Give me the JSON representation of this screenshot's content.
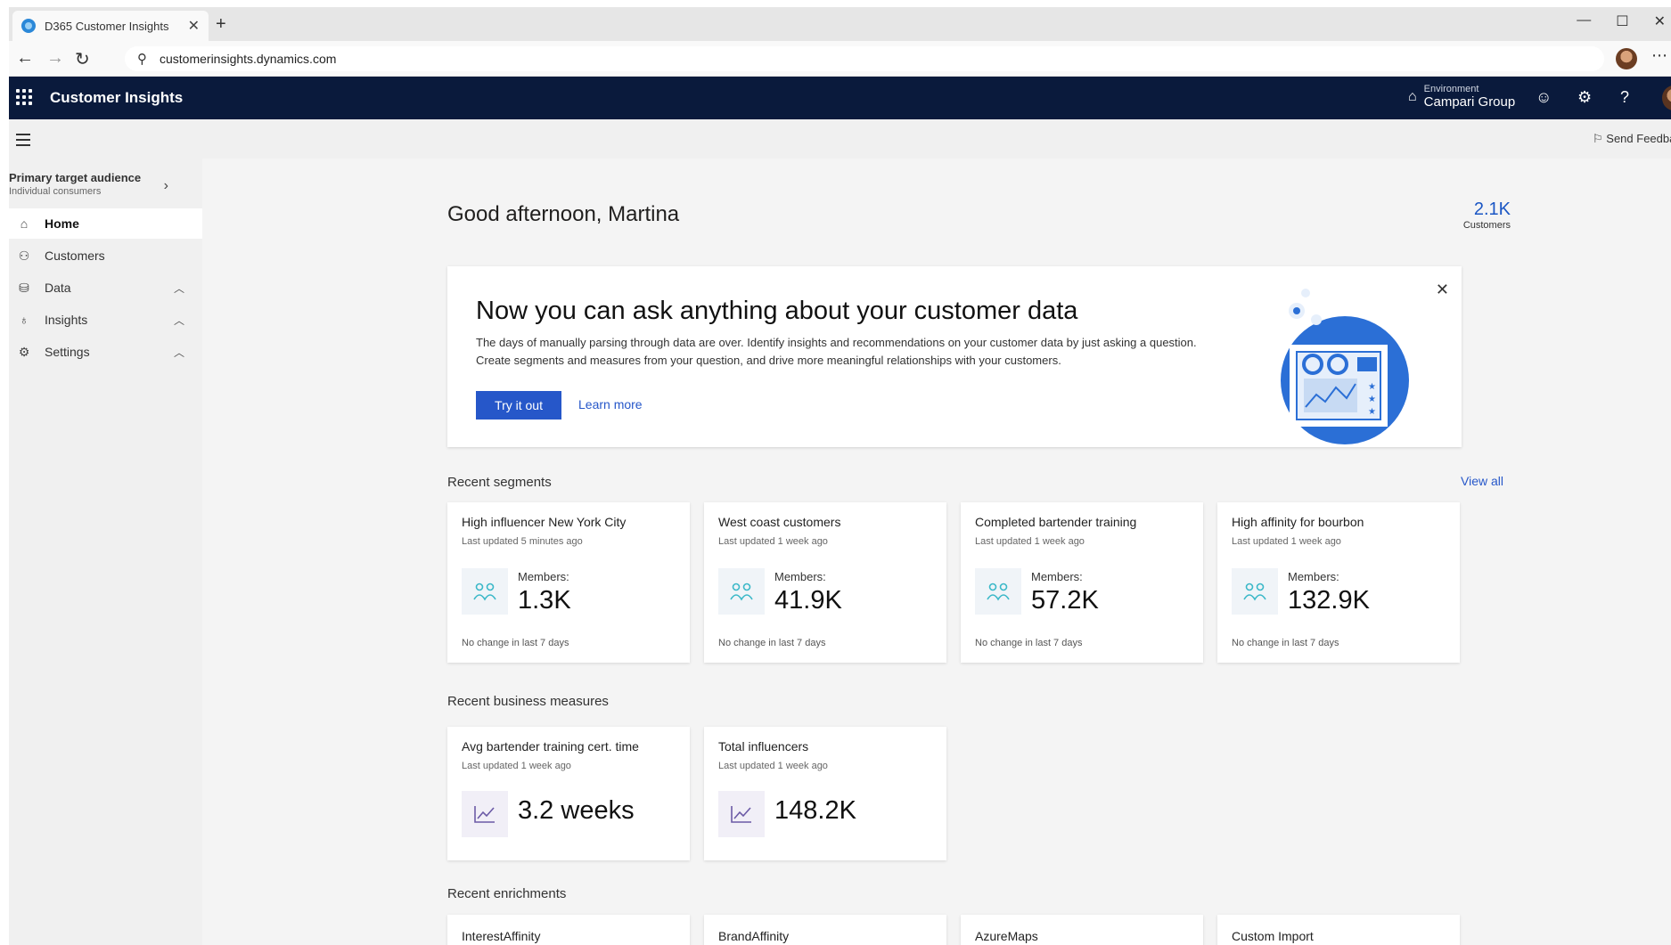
{
  "browser": {
    "tab_title": "D365 Customer Insights",
    "url": "customerinsights.dynamics.com"
  },
  "header": {
    "app_name": "Customer Insights",
    "environment_label": "Environment",
    "environment_value": "Campari Group"
  },
  "sidebar": {
    "audience_title": "Primary target audience",
    "audience_subtitle": "Individual consumers",
    "items": [
      {
        "label": "Home",
        "icon": "home-icon",
        "active": true
      },
      {
        "label": "Customers",
        "icon": "customers-icon"
      },
      {
        "label": "Data",
        "icon": "database-icon",
        "expandable": true
      },
      {
        "label": "Insights",
        "icon": "lightbulb-icon",
        "expandable": true
      },
      {
        "label": "Settings",
        "icon": "gear-icon",
        "expandable": true
      }
    ]
  },
  "main": {
    "send_feedback": "Send Feedbac",
    "greeting": "Good afternoon, Martina",
    "customers_count": "2.1K",
    "customers_label": "Customers",
    "hero": {
      "title": "Now you can ask anything about your customer data",
      "body": "The days of manually parsing through data are over. Identify insights and recommendations on your customer data by just asking a question. Create segments and measures from your question, and drive more meaningful relationships with your customers.",
      "primary_button": "Try it out",
      "secondary_link": "Learn more"
    },
    "segments": {
      "heading": "Recent segments",
      "view_all": "View all",
      "members_label": "Members:",
      "cards": [
        {
          "title": "High influencer New York City",
          "updated": "Last updated 5 minutes ago",
          "members": "1.3K",
          "footer": "No change in last 7 days"
        },
        {
          "title": "West coast customers",
          "updated": "Last updated 1 week ago",
          "members": "41.9K",
          "footer": "No change in last 7 days"
        },
        {
          "title": "Completed bartender training",
          "updated": "Last updated 1 week ago",
          "members": "57.2K",
          "footer": "No change in last 7 days"
        },
        {
          "title": "High affinity for bourbon",
          "updated": "Last updated 1 week ago",
          "members": "132.9K",
          "footer": "No change in last 7 days"
        }
      ]
    },
    "measures": {
      "heading": "Recent business measures",
      "cards": [
        {
          "title": "Avg bartender training cert. time",
          "updated": "Last updated 1 week ago",
          "value": "3.2 weeks"
        },
        {
          "title": "Total influencers",
          "updated": "Last updated 1 week ago",
          "value": "148.2K"
        }
      ]
    },
    "enrichments": {
      "heading": "Recent enrichments",
      "cards": [
        {
          "title": "InterestAffinity"
        },
        {
          "title": "BrandAffinity"
        },
        {
          "title": "AzureMaps"
        },
        {
          "title": "Custom Import"
        }
      ]
    }
  },
  "colors": {
    "header_bg": "#0a1a3c",
    "accent": "#2657c9",
    "segment_icon": "#3bb8c8",
    "measure_icon": "#6b5aa6"
  }
}
